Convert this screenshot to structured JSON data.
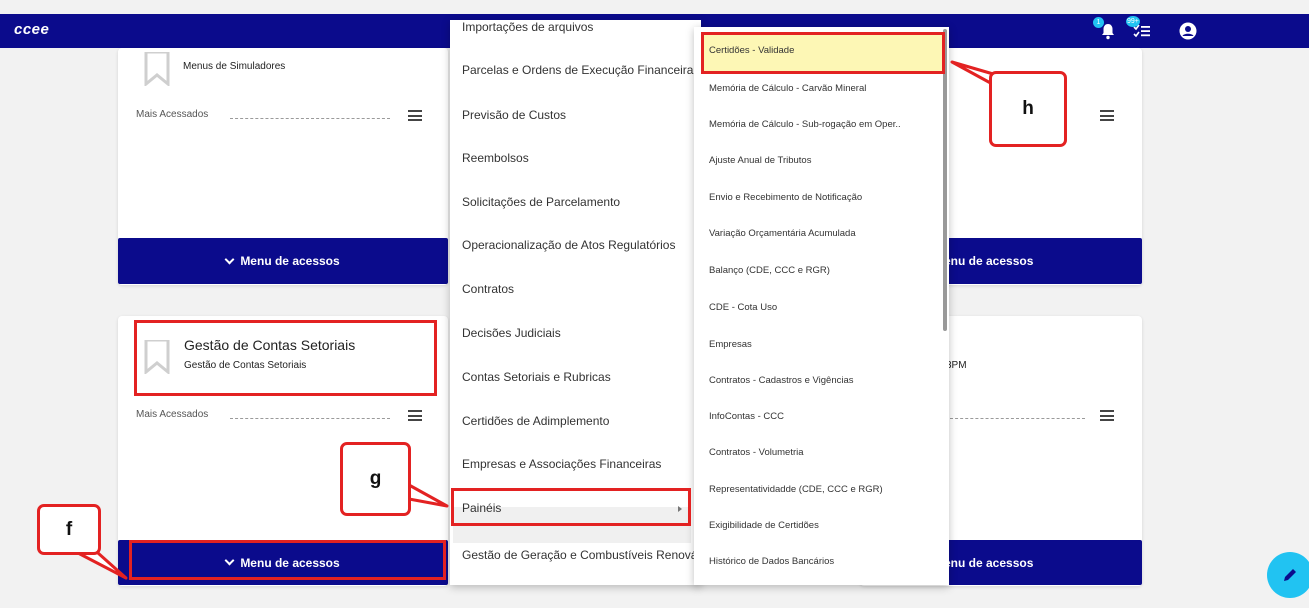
{
  "app": {
    "brand": "ccee"
  },
  "topbar": {
    "notifications_badge": "1",
    "tasks_badge": "99+",
    "icons": [
      "bell-icon",
      "tasks-icon",
      "user-icon"
    ]
  },
  "cards": {
    "simuladores": {
      "subtitle": "Menus de Simuladores",
      "mais_acessados": "Mais Acessados",
      "menu_button": "Menu de acessos"
    },
    "right_top": {
      "menu_button": "enu de acessos"
    },
    "gestao": {
      "title": "Gestão de Contas Setoriais",
      "subtitle": "Gestão de Contas Setoriais",
      "mais_acessados": "Mais Acessados",
      "menu_button": "Menu de acessos"
    },
    "right_bottom": {
      "subtitle_fragment": "3PM",
      "menu_button": "enu de acessos"
    }
  },
  "menu_level1": {
    "items": [
      "Importações de arquivos",
      "Parcelas e Ordens de Execução Financeira",
      "Previsão de Custos",
      "Reembolsos",
      "Solicitações de Parcelamento",
      "Operacionalização de Atos Regulatórios",
      "Contratos",
      "Decisões Judiciais",
      "Contas Setoriais e Rubricas",
      "Certidões de Adimplemento",
      "Empresas e Associações Financeiras",
      "Painéis",
      "Gestão de Geração e Combustíveis Renováveis"
    ],
    "active_item": "Painéis"
  },
  "menu_level2": {
    "items": [
      "Certidões - Validade",
      "Memória de Cálculo - Carvão Mineral",
      "Memória de Cálculo - Sub-rogação em Oper..",
      "Ajuste Anual de Tributos",
      "Envio e Recebimento de Notificação",
      "Variação Orçamentária Acumulada",
      "Balanço (CDE, CCC e RGR)",
      "CDE - Cota Uso",
      "Empresas",
      "Contratos - Cadastros e Vigências",
      "InfoContas - CCC",
      "Contratos - Volumetria",
      "Representatividadde (CDE, CCC e RGR)",
      "Exigibilidade de Certidões",
      "Histórico de Dados Bancários"
    ],
    "highlighted_item": "Certidões - Validade"
  },
  "callouts": {
    "f": "f",
    "g": "g",
    "h": "h"
  },
  "fab": {
    "icon": "pencil-icon"
  },
  "colors": {
    "navy": "#0b0b8c",
    "accent": "#21c3f2",
    "annotation_red": "#e32222",
    "highlight": "#fdf7b5"
  }
}
